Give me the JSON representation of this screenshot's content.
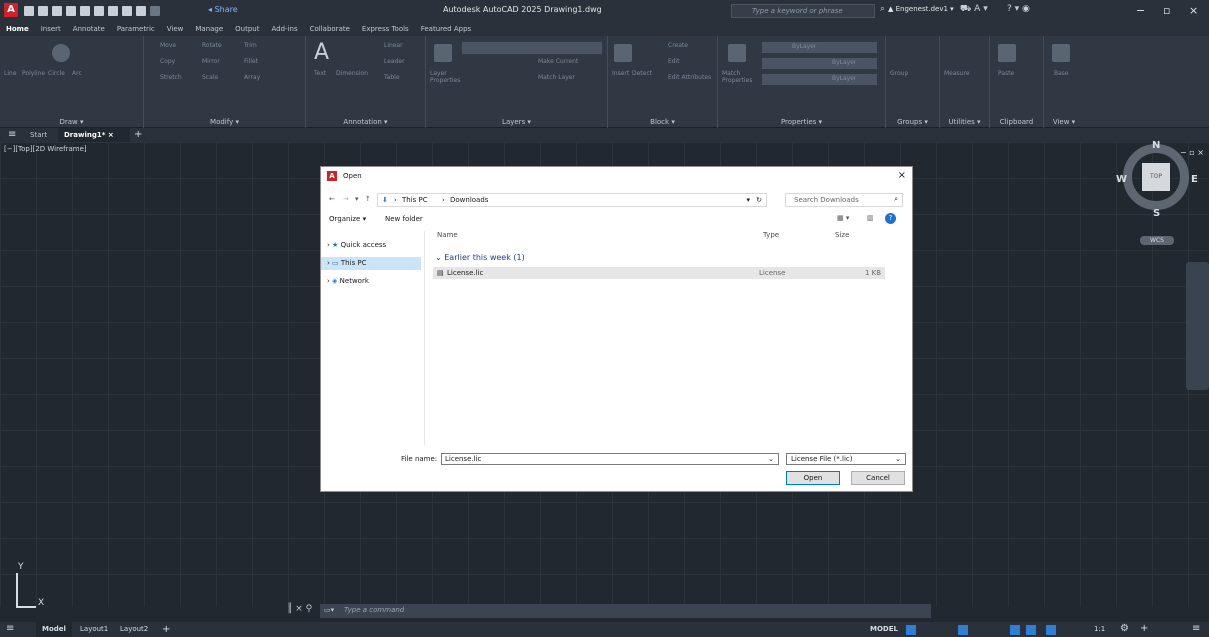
{
  "title_bar": {
    "app_logo": "A",
    "share_label": "Share",
    "title": "Autodesk AutoCAD 2025  Drawing1.dwg",
    "search_placeholder": "Type a keyword or phrase",
    "user": "Engenest.dev1"
  },
  "ribbon_tabs": [
    "Home",
    "Insert",
    "Annotate",
    "Parametric",
    "View",
    "Manage",
    "Output",
    "Add-ins",
    "Collaborate",
    "Express Tools",
    "Featured Apps"
  ],
  "ribbon_panels": {
    "draw": {
      "label": "Draw ▾",
      "tools": [
        "Line",
        "Polyline",
        "Circle",
        "Arc"
      ]
    },
    "modify": {
      "label": "Modify ▾",
      "tools": [
        "Move",
        "Rotate",
        "Trim",
        "Copy",
        "Mirror",
        "Fillet",
        "Stretch",
        "Scale",
        "Array"
      ]
    },
    "annotation": {
      "label": "Annotation ▾",
      "tools": [
        "Text",
        "Dimension",
        "Linear",
        "Leader",
        "Table"
      ]
    },
    "layers": {
      "label": "Layers ▾",
      "tools": [
        "Layer Properties",
        "Make Current",
        "Match Layer"
      ]
    },
    "block": {
      "label": "Block ▾",
      "tools": [
        "Insert",
        "Detect",
        "Create",
        "Edit",
        "Edit Attributes"
      ]
    },
    "properties": {
      "label": "Properties ▾",
      "tools": [
        "Match Properties",
        "ByLayer",
        "ByLayer",
        "ByLayer"
      ]
    },
    "groups": {
      "label": "Groups ▾",
      "tools": [
        "Group"
      ]
    },
    "utilities": {
      "label": "Utilities ▾",
      "tools": [
        "Measure"
      ]
    },
    "clipboard": {
      "label": "Clipboard",
      "tools": [
        "Paste"
      ]
    },
    "view": {
      "label": "View ▾",
      "tools": [
        "Base"
      ]
    }
  },
  "doc_tabs": {
    "start": "Start",
    "active": "Drawing1*",
    "close": "×",
    "add": "+"
  },
  "viewport_label": "[−][Top][2D Wireframe]",
  "viewport_controls": "− ▫ ×",
  "viewcube": {
    "n": "N",
    "s": "S",
    "e": "E",
    "w": "W",
    "top": "TOP",
    "wcs": "WCS"
  },
  "ucs": {
    "x": "X",
    "y": "Y"
  },
  "dialog": {
    "title": "Open",
    "close": "×",
    "breadcrumb": [
      "This PC",
      "Downloads"
    ],
    "search_placeholder": "Search Downloads",
    "organize": "Organize ▾",
    "new_folder": "New folder",
    "nav": [
      "Quick access",
      "This PC",
      "Network"
    ],
    "columns": {
      "name": "Name",
      "type": "Type",
      "size": "Size"
    },
    "group": "Earlier this week (1)",
    "file": {
      "name": "License.lic",
      "type": "License",
      "size": "1 KB"
    },
    "file_name_label": "File name:",
    "file_name_value": "License.lic",
    "file_type": "License File (*.lic)",
    "open": "Open",
    "cancel": "Cancel"
  },
  "command": {
    "placeholder": "Type a command"
  },
  "status": {
    "model_tab": "Model",
    "layout1": "Layout1",
    "layout2": "Layout2",
    "add": "+",
    "model": "MODEL",
    "scale": "1:1"
  }
}
